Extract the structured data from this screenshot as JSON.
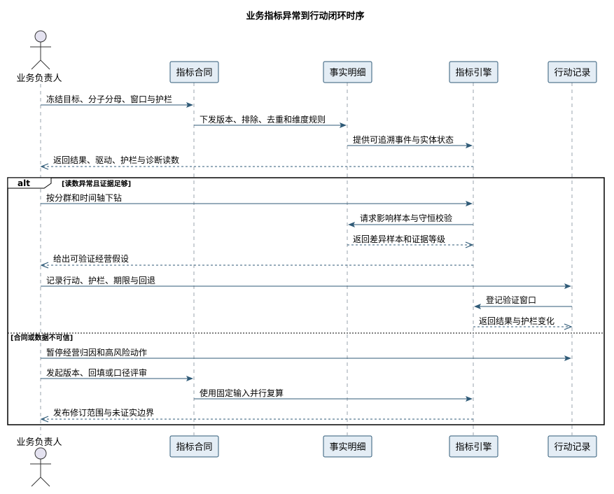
{
  "title": "业务指标异常到行动闭环时序",
  "participants": [
    {
      "id": "biz",
      "label": "业务负责人",
      "kind": "actor"
    },
    {
      "id": "contract",
      "label": "指标合同",
      "kind": "box"
    },
    {
      "id": "facts",
      "label": "事实明细",
      "kind": "box"
    },
    {
      "id": "engine",
      "label": "指标引擎",
      "kind": "box"
    },
    {
      "id": "actions",
      "label": "行动记录",
      "kind": "box"
    }
  ],
  "messages": [
    {
      "from": "biz",
      "to": "contract",
      "text": "冻结目标、分子分母、窗口与护栏",
      "style": "solid"
    },
    {
      "from": "contract",
      "to": "facts",
      "text": "下发版本、排除、去重和维度规则",
      "style": "solid"
    },
    {
      "from": "facts",
      "to": "engine",
      "text": "提供可追溯事件与实体状态",
      "style": "solid"
    },
    {
      "from": "engine",
      "to": "biz",
      "text": "返回结果、驱动、护栏与诊断读数",
      "style": "dashed"
    },
    {
      "from": "biz",
      "to": "engine",
      "text": "按分群和时间轴下钻",
      "style": "solid"
    },
    {
      "from": "engine",
      "to": "facts",
      "text": "请求影响样本与守恒校验",
      "style": "solid"
    },
    {
      "from": "facts",
      "to": "engine",
      "text": "返回差异样本和证据等级",
      "style": "dashed"
    },
    {
      "from": "engine",
      "to": "biz",
      "text": "给出可验证经营假设",
      "style": "dashed"
    },
    {
      "from": "biz",
      "to": "actions",
      "text": "记录行动、护栏、期限与回退",
      "style": "solid"
    },
    {
      "from": "actions",
      "to": "engine",
      "text": "登记验证窗口",
      "style": "solid"
    },
    {
      "from": "engine",
      "to": "actions",
      "text": "返回结果与护栏变化",
      "style": "dashed"
    },
    {
      "from": "biz",
      "to": "actions",
      "text": "暂停经营归因和高风险动作",
      "style": "solid"
    },
    {
      "from": "biz",
      "to": "contract",
      "text": "发起版本、回填或口径评审",
      "style": "solid"
    },
    {
      "from": "contract",
      "to": "engine",
      "text": "使用固定输入并行复算",
      "style": "solid"
    },
    {
      "from": "engine",
      "to": "biz",
      "text": "发布修订范围与未证实边界",
      "style": "dashed"
    }
  ],
  "fragment": {
    "keyword": "alt",
    "guard": "[读数异常且证据足够]",
    "else_guard": "[合同或数据不可信]"
  }
}
